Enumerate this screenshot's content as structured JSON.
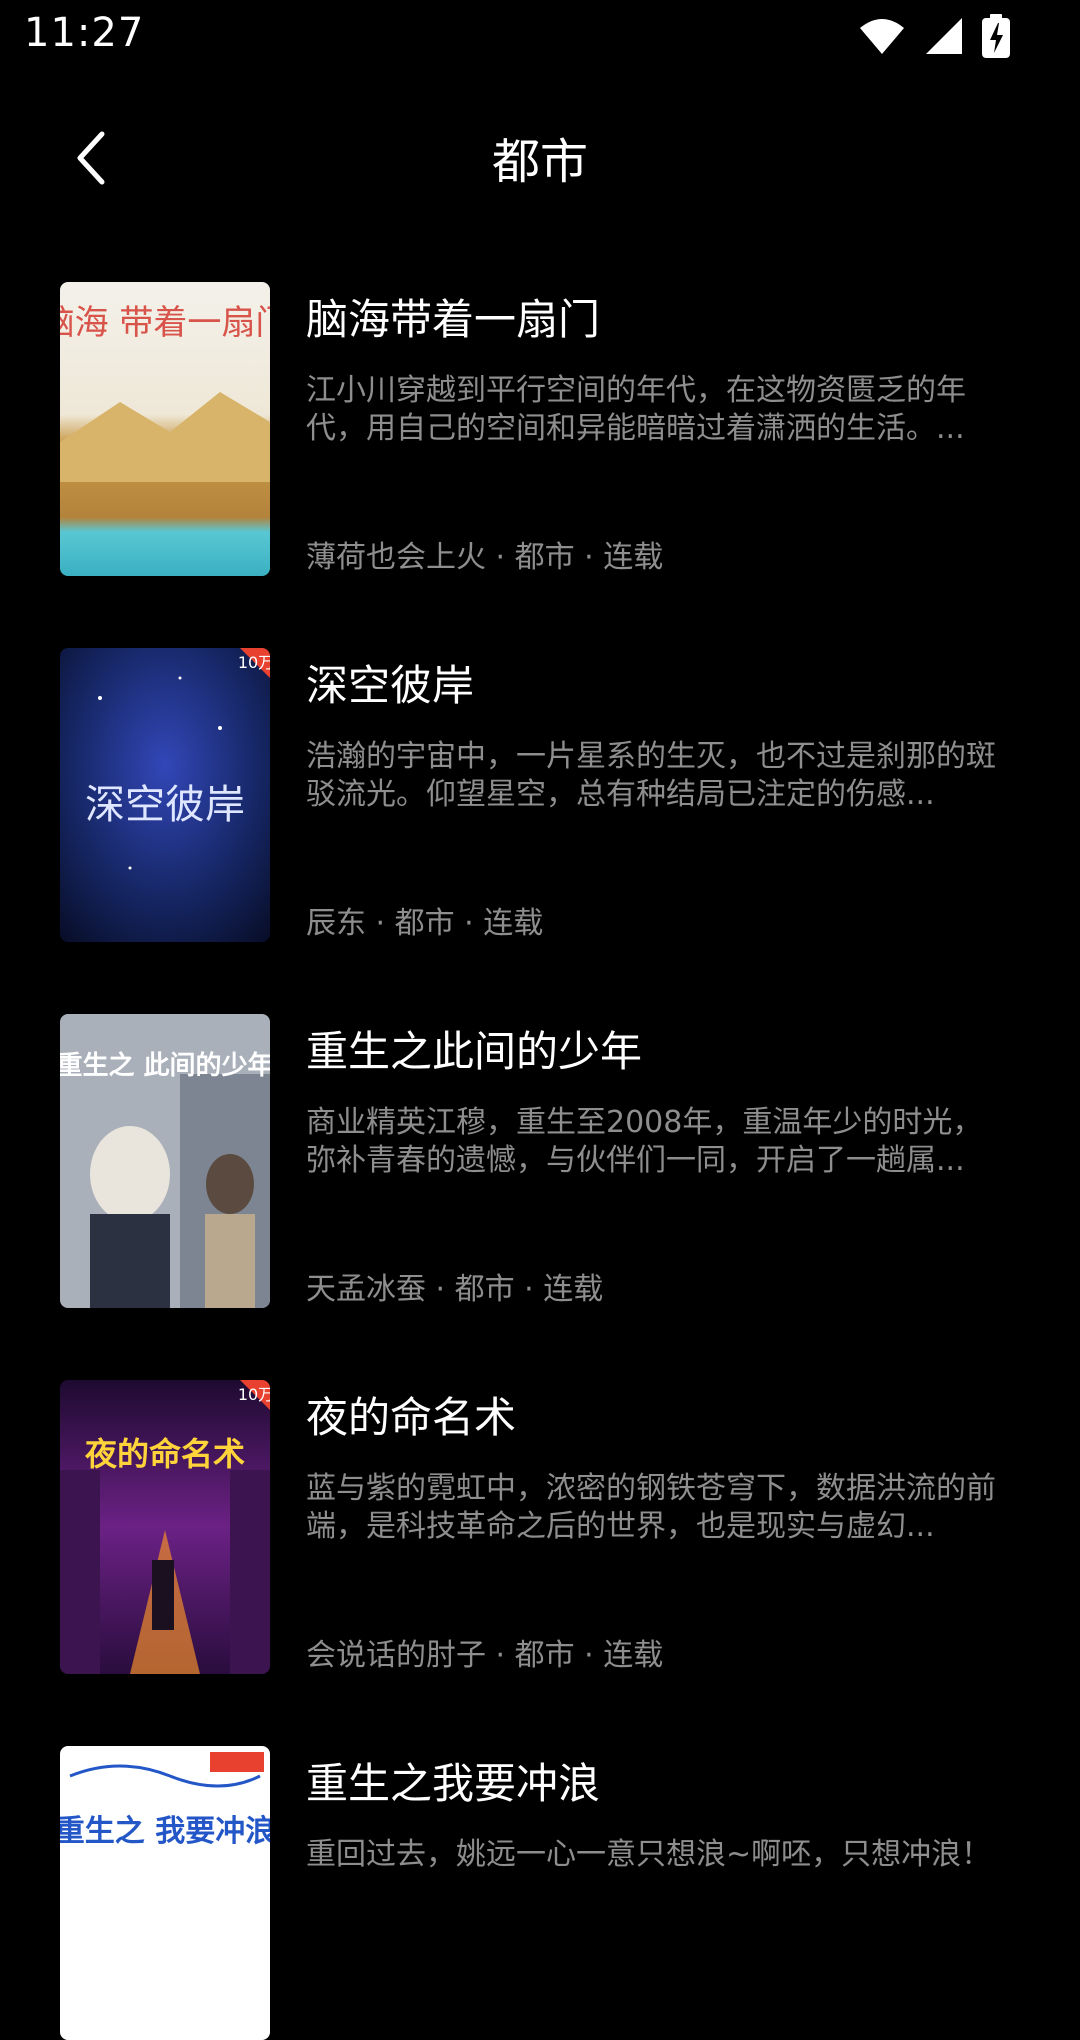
{
  "status_bar": {
    "time": "11:27"
  },
  "header": {
    "title": "都市"
  },
  "books": [
    {
      "title": "脑海带着一扇门",
      "description": "江小川穿越到平行空间的年代，在这物资匮乏的年代，用自己的空间和异能暗暗过着潇洒的生活。...",
      "meta": "薄荷也会上火 · 都市 · 连载",
      "cover_text": "脑海 带着一扇门",
      "cover_colors": [
        "#f1efe6",
        "#c99a47",
        "#59c7d3"
      ]
    },
    {
      "title": "深空彼岸",
      "description": "浩瀚的宇宙中，一片星系的生灭，也不过是刹那的斑驳流光。仰望星空，总有种结局已注定的伤感...",
      "meta": "辰东 · 都市 · 连载",
      "cover_text": "深空彼岸",
      "cover_badge": "10万",
      "cover_colors": [
        "#0b1a4e",
        "#2d3da0",
        "#0a0f2a"
      ]
    },
    {
      "title": "重生之此间的少年",
      "description": "商业精英江穆，重生至2008年，重温年少的时光，弥补青春的遗憾，与伙伴们一同，开启了一趟属...",
      "meta": "天孟冰蚕 · 都市 · 连载",
      "cover_text": "重生之 此间的少年",
      "cover_colors": [
        "#9ea7b3",
        "#c7ccd3",
        "#6e7480"
      ]
    },
    {
      "title": "夜的命名术",
      "description": "蓝与紫的霓虹中，浓密的钢铁苍穹下，数据洪流的前端，是科技革命之后的世界，也是现实与虚幻...",
      "meta": "会说话的肘子 · 都市 · 连载",
      "cover_text": "夜的命名术",
      "cover_badge": "10万",
      "cover_colors": [
        "#2a0d3e",
        "#8a2a9c",
        "#f08b2b"
      ]
    },
    {
      "title": "重生之我要冲浪",
      "description": "重回过去，姚远一心一意只想浪~啊呸，只想冲浪！",
      "meta": "",
      "cover_text": "重生之 我要冲浪",
      "cover_colors": [
        "#ffffff",
        "#2356c7",
        "#e7c53a"
      ]
    }
  ]
}
